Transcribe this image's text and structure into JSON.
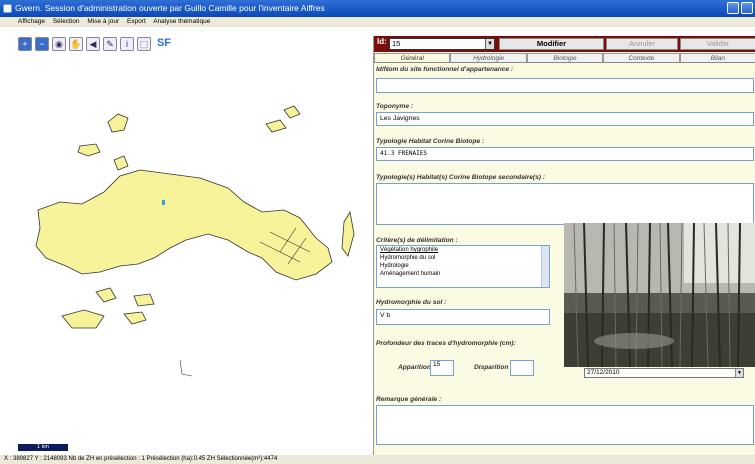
{
  "window": {
    "title": "Gwern. Session d'administration ouverte par Guillo Camille pour l'inventaire Aiffres"
  },
  "menu": [
    "Affichage",
    "Sélection",
    "Mise à jour",
    "Export",
    "Analyse thématique"
  ],
  "toolbar": {
    "sf_label": "SF"
  },
  "map": {
    "fill_color": "#f7f39a",
    "stroke_color": "#333333",
    "scale_label": "1 km"
  },
  "status": "X : 389827   Y : 2148093    Nb de ZH en présélection : 1    Présélection (ha):0.45    ZH Sélectionnée(m²):4474",
  "panel": {
    "id_label": "Id:",
    "id_value": "15",
    "buttons": {
      "modifier": "Modifier",
      "annuler": "Annuler",
      "valider": "Valider"
    },
    "tabs": [
      "Général",
      "Hydrologie",
      "Biologie",
      "Contexte",
      "Bilan"
    ],
    "fields": {
      "site_label": "Id/Nom du site fonctionnel d'appartenance :",
      "site_value": "",
      "toponyme_label": "Toponyme :",
      "toponyme_value": "Les Javignes",
      "corine_label": "Typologie Habitat Corine Biotope :",
      "corine_value": "41.3  FRENAIES",
      "corine_sec_label": "Typologie(s) Habitat(s) Corine Biotope secondaire(s) :",
      "corine_sec_value": "",
      "criteres_label": "Critère(s) de délimitation :",
      "criteres_options": [
        "Végétation hygrophile",
        "Hydromorphie du sol",
        "Hydrologie",
        "Aménagement humain"
      ],
      "hydromorphie_label": "Hydromorphie du sol :",
      "hydromorphie_value": "V b",
      "profondeur_label": "Profondeur des traces d'hydromorphie (cm):",
      "apparition_label": "Apparition",
      "apparition_value": "15",
      "disparition_label": "Disparition",
      "disparition_value": "",
      "remarque_label": "Remarque générale :",
      "remarque_value": ""
    },
    "photo_date": "27/12/2010"
  }
}
